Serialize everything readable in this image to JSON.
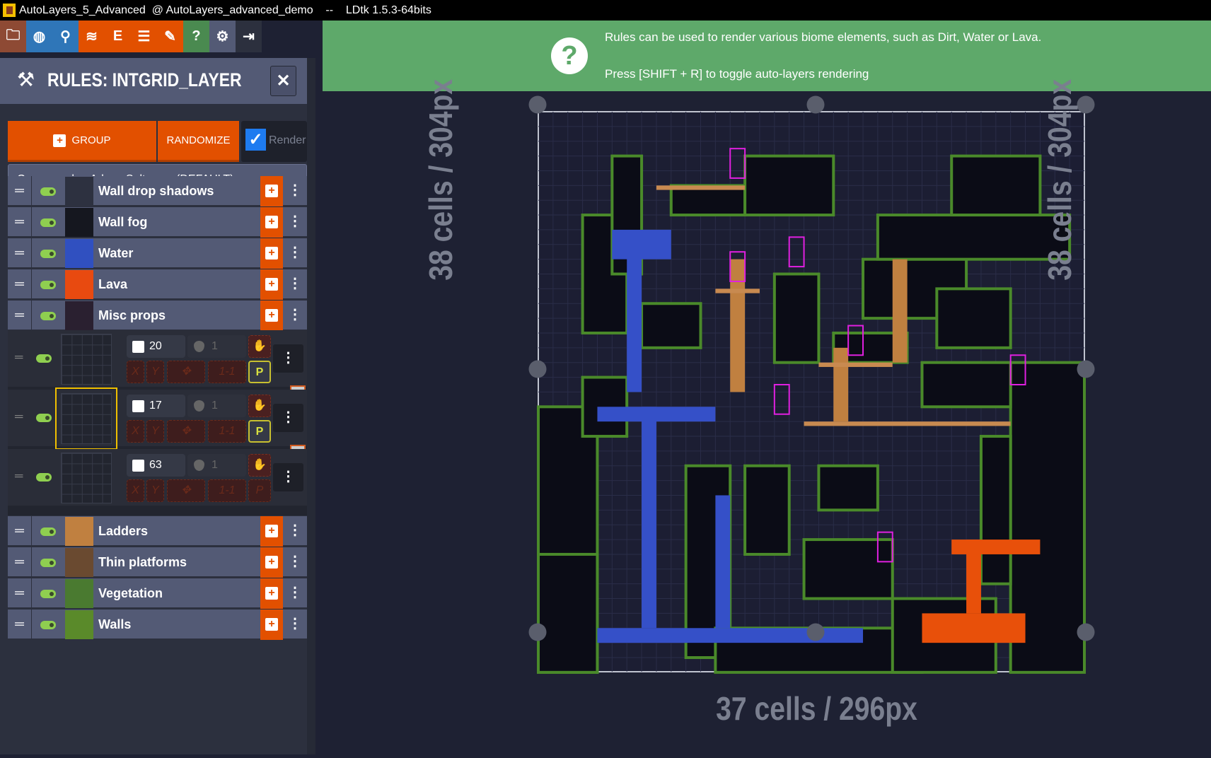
{
  "window": {
    "title": "AutoLayers_5_Advanced  @ AutoLayers_advanced_demo    --    LDtk 1.5.3-64bits"
  },
  "toolbar": {
    "icons": [
      {
        "name": "project-settings-icon",
        "color": "#8e4a34",
        "glyph": "🗀"
      },
      {
        "name": "world-icon",
        "color": "#2f76b8",
        "glyph": "◍"
      },
      {
        "name": "location-pin-icon",
        "color": "#2f76b8",
        "glyph": "⚲"
      },
      {
        "name": "layers-icon",
        "color": "#e25000",
        "glyph": "≋"
      },
      {
        "name": "entities-icon",
        "color": "#e25000",
        "glyph": "E"
      },
      {
        "name": "enums-list-icon",
        "color": "#e25000",
        "glyph": "☰"
      },
      {
        "name": "tilesets-brush-icon",
        "color": "#e25000",
        "glyph": "✎"
      },
      {
        "name": "help-icon",
        "color": "#4a8a50",
        "glyph": "?"
      },
      {
        "name": "settings-gear-icon",
        "color": "#535a75",
        "glyph": "⚙"
      },
      {
        "name": "exit-icon",
        "color": "#2c303e",
        "glyph": "⇥"
      }
    ]
  },
  "banner": {
    "line1": "Rules can be used to render various biome elements, such as Dirt, Water or Lava.",
    "line2": "Press [SHIFT + R] to toggle auto-layers rendering",
    "icon": "?"
  },
  "panel": {
    "title": "RULES: INTGRID_LAYER",
    "close": "✕",
    "group_label": "GROUP",
    "randomize_label": "RANDOMIZE",
    "render_label": "Render",
    "render_checked": true,
    "preset": "Cavernas_by_Adam_Saltsman (DEFAULT)"
  },
  "groups_top": [
    {
      "label": "Wall drop shadows",
      "thumb": "#2d3140"
    },
    {
      "label": "Wall fog",
      "thumb": "#15171f"
    },
    {
      "label": "Water",
      "thumb": "#3050c0"
    },
    {
      "label": "Lava",
      "thumb": "#e84a10"
    },
    {
      "label": "Misc props",
      "thumb": "#2a2030"
    }
  ],
  "sub_rules": [
    {
      "chance": "20",
      "flow": "1",
      "offset": "1-1",
      "x": "X",
      "y": "Y",
      "p": "P",
      "p_active": true
    },
    {
      "chance": "17",
      "flow": "1",
      "offset": "1-1",
      "x": "X",
      "y": "Y",
      "p": "P",
      "p_active": true
    },
    {
      "chance": "63",
      "flow": "1",
      "offset": "1-1",
      "x": "X",
      "y": "Y",
      "p": "P",
      "p_active": false
    }
  ],
  "groups_bottom": [
    {
      "label": "Ladders",
      "thumb": "#c08040"
    },
    {
      "label": "Thin platforms",
      "thumb": "#6a4a30"
    },
    {
      "label": "Vegetation",
      "thumb": "#4a7a30"
    },
    {
      "label": "Walls",
      "thumb": "#5a8a2a"
    }
  ],
  "canvas": {
    "height_label": "38 cells / 304px",
    "width_label": "37 cells / 296px"
  },
  "colors": {
    "accent": "#e25000",
    "banner": "#5ea96a",
    "panel": "#535a75",
    "toggle": "#8fcf50"
  }
}
